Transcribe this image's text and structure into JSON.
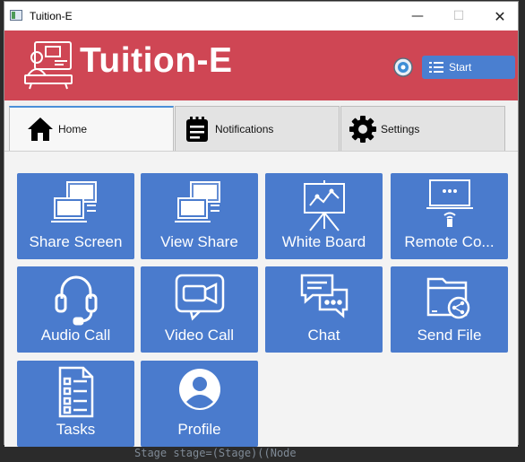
{
  "window": {
    "title": "Tuition-E"
  },
  "header": {
    "brand": "Tuition-E",
    "start_label": "Start"
  },
  "tabs": [
    {
      "label": "Home",
      "active": true,
      "icon": "home-icon"
    },
    {
      "label": "Notifications",
      "active": false,
      "icon": "notes-icon"
    },
    {
      "label": "Settings",
      "active": false,
      "icon": "gear-icon"
    }
  ],
  "tiles": [
    {
      "label": "Share Screen",
      "icon": "share-screen-icon"
    },
    {
      "label": "View Share",
      "icon": "view-share-icon"
    },
    {
      "label": "White Board",
      "icon": "whiteboard-icon"
    },
    {
      "label": "Remote Co...",
      "icon": "remote-control-icon"
    },
    {
      "label": "Audio Call",
      "icon": "headset-icon"
    },
    {
      "label": "Video Call",
      "icon": "video-camera-icon"
    },
    {
      "label": "Chat",
      "icon": "chat-bubbles-icon"
    },
    {
      "label": "Send File",
      "icon": "share-folder-icon"
    },
    {
      "label": "Tasks",
      "icon": "checklist-icon"
    },
    {
      "label": "Profile",
      "icon": "user-profile-icon"
    }
  ],
  "colors": {
    "header": "#cf4654",
    "tile": "#4a7bcd",
    "start": "#4a7fd0"
  },
  "background_code": "Stage stage=(Stage)((Node"
}
